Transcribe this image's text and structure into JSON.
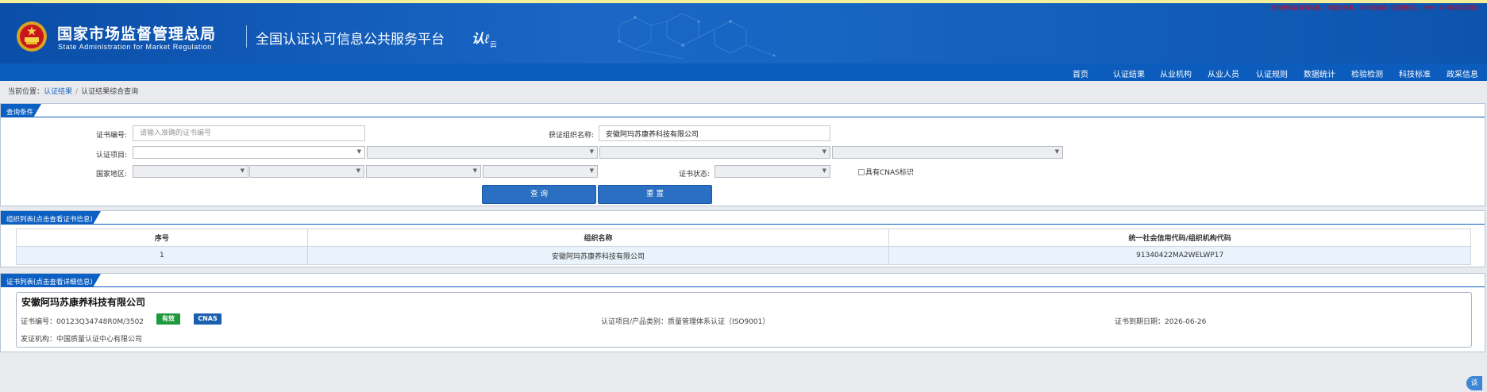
{
  "header": {
    "org_cn": "国家市场监督管理总局",
    "org_en": "State Administration  for  Market Regulation",
    "platform": "全国认证认可信息公共服务平台",
    "cloud_logo": "认",
    "cloud_logo_suffix": "云",
    "browser_tip": "建议使用谷歌浏览器、火狐浏览器、360浏览器（极速模式），IE9+（非兼容性视图）"
  },
  "nav": [
    "首页",
    "认证结果",
    "从业机构",
    "从业人员",
    "认证规则",
    "数据统计",
    "检验检测",
    "科技标准",
    "政采信息"
  ],
  "breadcrumb": {
    "prefix": "当前位置：",
    "link": "认证结果",
    "current": "认证结果综合查询"
  },
  "query": {
    "panel_title": "查询条件",
    "cert_no_label": "证书编号:",
    "cert_no_placeholder": "请输入准确的证书编号",
    "org_label": "获证组织名称:",
    "org_value": "安徽阿玛苏康养科技有限公司",
    "item_label": "认证项目:",
    "region_label": "国家地区:",
    "status_label": "证书状态:",
    "cnas_label": "具有CNAS标识",
    "search_btn": "查 询",
    "reset_btn": "重 置"
  },
  "org_list": {
    "panel_title": "组织列表(点击查看证书信息)",
    "columns": [
      "序号",
      "组织名称",
      "统一社会信用代码/组织机构代码"
    ],
    "rows": [
      {
        "no": "1",
        "name": "安徽阿玛苏康养科技有限公司",
        "code": "91340422MA2WELWP17"
      }
    ]
  },
  "cert_list": {
    "panel_title": "证书列表(点击查看详细信息)",
    "company": "安徽阿玛苏康养科技有限公司",
    "cert_no": "证书编号：00123Q34748R0M/3502",
    "status_badge": "有效",
    "cnas_badge": "CNAS",
    "project": "认证项目/产品类别：质量管理体系认证（ISO9001）",
    "expiry": "证书到期日期：2026-06-26",
    "issuer": "发证机构：中国质量认证中心有限公司"
  },
  "float_btn": "谈",
  "colors": {
    "brand_blue": "#0d60c3",
    "valid_green": "#1e9a3c",
    "cnas_blue": "#1b5fae"
  }
}
